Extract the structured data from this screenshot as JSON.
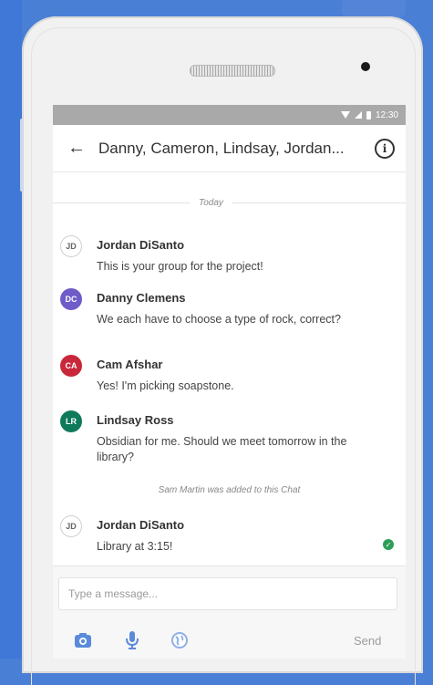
{
  "status_bar": {
    "time": "12:30"
  },
  "app_bar": {
    "back_icon": "arrow-left-icon",
    "title": "Danny, Cameron, Lindsay, Jordan...",
    "info_icon": "info-icon"
  },
  "chat": {
    "date_divider": "Today",
    "messages": [
      {
        "initials": "JD",
        "sender": "Jordan DiSanto",
        "text": "This is your group for the project!",
        "avatar_color": "#ffffff"
      },
      {
        "initials": "DC",
        "sender": "Danny Clemens",
        "text": "We each have to choose a type of rock, correct?",
        "avatar_color": "#6f5cc9"
      },
      {
        "initials": "CA",
        "sender": "Cam Afshar",
        "text": "Yes! I'm picking soapstone.",
        "avatar_color": "#c9283a"
      },
      {
        "initials": "LR",
        "sender": "Lindsay Ross",
        "text": "Obsidian for me. Should we meet tomorrow in the library?",
        "avatar_color": "#0f7a5a"
      }
    ],
    "system_notice": "Sam Martin was added to this Chat",
    "last_message": {
      "initials": "JD",
      "sender": "Jordan DiSanto",
      "text": "Library at 3:15!",
      "status_icon": "delivered-check-icon"
    }
  },
  "composer": {
    "placeholder": "Type a message...",
    "tools": [
      "camera-icon",
      "microphone-icon",
      "globe-icon"
    ],
    "send_label": "Send"
  }
}
